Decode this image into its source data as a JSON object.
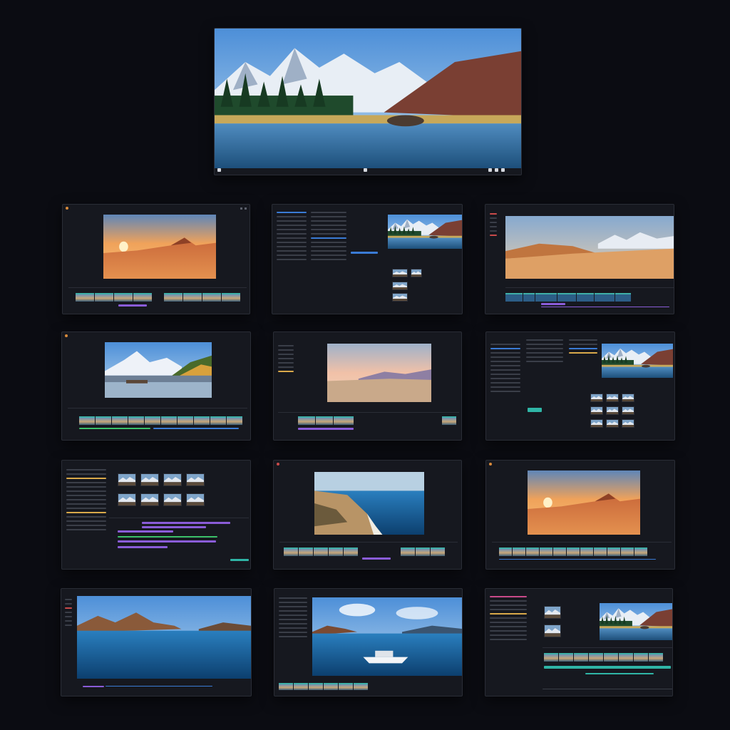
{
  "page": {
    "background": "#0b0c12",
    "accent_blue": "#3a7bd5",
    "accent_purple": "#8a5cd8",
    "accent_teal": "#2fb5a6",
    "accent_gold": "#d9a94a"
  },
  "hero": {
    "scene": "mountain-lake",
    "controls": [
      "export-icon",
      "play-icon",
      "settings-icon",
      "more-icon",
      "fullscreen-icon"
    ]
  },
  "windows": [
    {
      "id": "w1",
      "scene": "desert-sunset"
    },
    {
      "id": "w2",
      "scene": "mountain-lake"
    },
    {
      "id": "w3",
      "scene": "desert-dunes"
    },
    {
      "id": "w4",
      "scene": "mountain-river"
    },
    {
      "id": "w5",
      "scene": "pastel-desert"
    },
    {
      "id": "w6",
      "scene": "mountain-lake"
    },
    {
      "id": "w7",
      "scene": "thumbnail-grid"
    },
    {
      "id": "w8",
      "scene": "coastline"
    },
    {
      "id": "w9",
      "scene": "desert-sunset"
    },
    {
      "id": "w10",
      "scene": "blue-lake"
    },
    {
      "id": "w11",
      "scene": "boat-lake"
    },
    {
      "id": "w12",
      "scene": "mountain-lake"
    }
  ]
}
